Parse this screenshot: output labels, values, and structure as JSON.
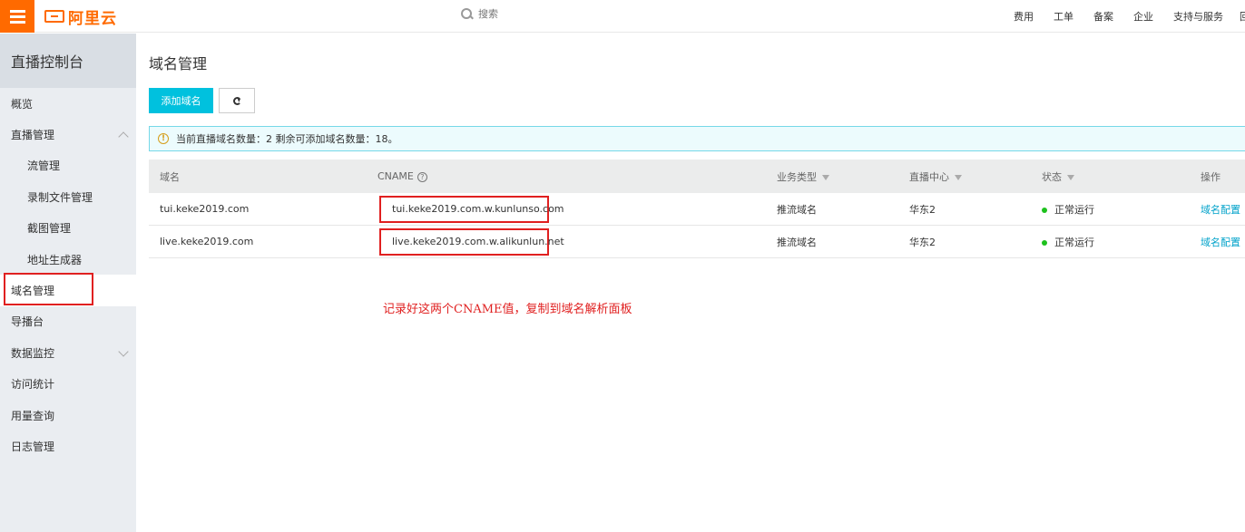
{
  "topbar": {
    "logo_text": "阿里云",
    "search_placeholder": "搜索",
    "links": [
      "费用",
      "工单",
      "备案",
      "企业",
      "支持与服务",
      "回"
    ],
    "accent_color": "#ff6a00"
  },
  "sidebar": {
    "title": "直播控制台",
    "items": [
      {
        "label": "概览"
      },
      {
        "label": "直播管理",
        "chevron": "chevron-up-icon"
      },
      {
        "label": "流管理",
        "sub": true
      },
      {
        "label": "录制文件管理",
        "sub": true
      },
      {
        "label": "截图管理",
        "sub": true
      },
      {
        "label": "地址生成器",
        "sub": true
      },
      {
        "label": "域名管理",
        "active": true
      },
      {
        "label": "导播台"
      },
      {
        "label": "数据监控",
        "chevron": "chevron-down-icon"
      },
      {
        "label": "访问统计"
      },
      {
        "label": "用量查询"
      },
      {
        "label": "日志管理"
      }
    ]
  },
  "main": {
    "title": "域名管理",
    "add_button": "添加域名",
    "alert_text": "当前直播域名数量：2 剩余可添加域名数量：18。",
    "table": {
      "headers": [
        "域名",
        "CNAME",
        "业务类型",
        "直播中心",
        "状态",
        "操作"
      ],
      "rows": [
        {
          "domain": "tui.keke2019.com",
          "cname": "tui.keke2019.com.w.kunlunso.com",
          "type": "推流域名",
          "center": "华东2",
          "status": "正常运行",
          "action": "域名配置"
        },
        {
          "domain": "live.keke2019.com",
          "cname": "live.keke2019.com.w.alikunlun.net",
          "type": "推流域名",
          "center": "华东2",
          "status": "正常运行",
          "action": "域名配置"
        }
      ]
    },
    "annotation": "记录好这两个CNAME值，复制到域名解析面板"
  }
}
